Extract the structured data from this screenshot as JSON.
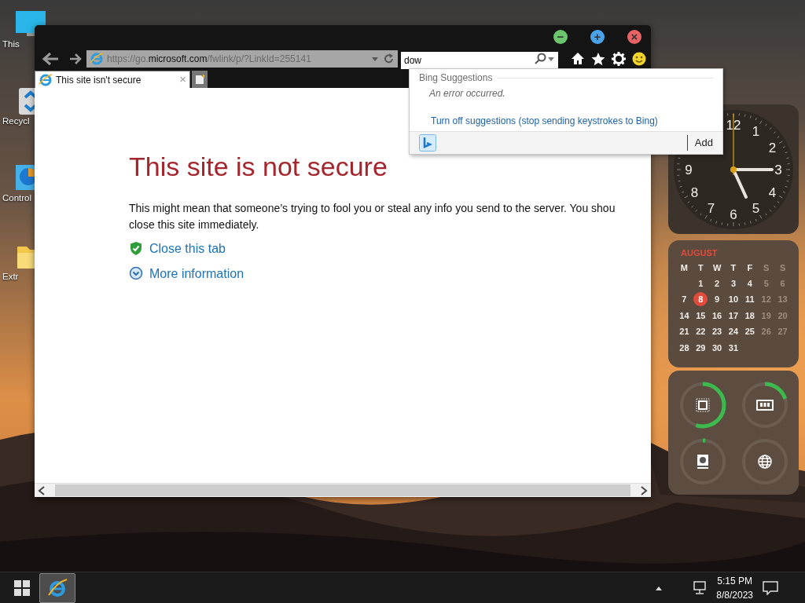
{
  "desktop_icons": [
    {
      "kind": "monitor",
      "label": "This"
    },
    {
      "kind": "recycle",
      "label": "Recycl"
    },
    {
      "kind": "control",
      "label": "Control"
    },
    {
      "kind": "folder",
      "label": "Extr"
    }
  ],
  "browser": {
    "window_buttons": [
      {
        "kind": "minimize",
        "label": "−"
      },
      {
        "kind": "maximize",
        "label": "+"
      },
      {
        "kind": "close",
        "label": "×"
      }
    ],
    "address": {
      "prefix": "https://go.",
      "domain": "microsoft.com",
      "path": "/fwlink/p/?LinkId=255141"
    },
    "search": {
      "value": "dow"
    },
    "tabs": [
      {
        "title": "This site isn't secure",
        "close_label": "×",
        "selected": true
      }
    ],
    "page": {
      "heading": "This site is not secure",
      "lines": [
        "This might mean that someone’s trying to fool you or steal any info you send to the server. You shou",
        "close this site immediately."
      ],
      "links": [
        {
          "kind": "close",
          "label": "Close this tab"
        },
        {
          "kind": "more",
          "label": "More information"
        }
      ]
    }
  },
  "suggestions": {
    "header": "Bing Suggestions",
    "message": "An error occurred.",
    "link": "Turn off suggestions (stop sending keystrokes to Bing)",
    "add_button": "Add"
  },
  "clock": {
    "numerals": [
      "12",
      "1",
      "2",
      "3",
      "4",
      "5",
      "6",
      "7",
      "8",
      "9"
    ]
  },
  "calendar": {
    "month": "AUGUST",
    "weekdays": [
      {
        "label": "M",
        "weekend": false
      },
      {
        "label": "T",
        "weekend": false
      },
      {
        "label": "W",
        "weekend": false
      },
      {
        "label": "T",
        "weekend": false
      },
      {
        "label": "F",
        "weekend": false
      },
      {
        "label": "S",
        "weekend": true
      },
      {
        "label": "S",
        "weekend": true
      }
    ],
    "weeks": [
      [
        {
          "day": "1",
          "selected": false
        },
        {
          "day": "2",
          "selected": false
        },
        {
          "day": "3",
          "selected": false
        },
        {
          "day": "4",
          "selected": false
        },
        {
          "day": "5",
          "selected": false
        },
        {
          "day": "6",
          "selected": false
        }
      ],
      [
        {
          "day": "7",
          "selected": false
        },
        {
          "day": "8",
          "selected": true
        },
        {
          "day": "9",
          "selected": false
        },
        {
          "day": "10",
          "selected": false
        },
        {
          "day": "11",
          "selected": false
        },
        {
          "day": "12",
          "selected": false
        },
        {
          "day": "13",
          "selected": false
        }
      ],
      [
        {
          "day": "14",
          "selected": false
        },
        {
          "day": "15",
          "selected": false
        },
        {
          "day": "16",
          "selected": false
        },
        {
          "day": "17",
          "selected": false
        },
        {
          "day": "18",
          "selected": false
        },
        {
          "day": "19",
          "selected": false
        },
        {
          "day": "20",
          "selected": false
        }
      ],
      [
        {
          "day": "21",
          "selected": false
        },
        {
          "day": "22",
          "selected": false
        },
        {
          "day": "23",
          "selected": false
        },
        {
          "day": "24",
          "selected": false
        },
        {
          "day": "25",
          "selected": false
        },
        {
          "day": "26",
          "selected": false
        },
        {
          "day": "27",
          "selected": false
        }
      ],
      [
        {
          "day": "28",
          "selected": false
        },
        {
          "day": "29",
          "selected": false
        },
        {
          "day": "30",
          "selected": false
        },
        {
          "day": "31",
          "selected": false
        }
      ]
    ]
  },
  "gauges": [
    {
      "kind": "cpu",
      "level": 0.55
    },
    {
      "kind": "ram",
      "level": 0.2
    },
    {
      "kind": "disk",
      "level": 0.02
    },
    {
      "kind": "network"
    }
  ],
  "taskbar": {
    "apps": [
      {
        "kind": "browser",
        "selected": true
      }
    ],
    "time": "5:15 PM",
    "date": "8/8/2023"
  }
}
